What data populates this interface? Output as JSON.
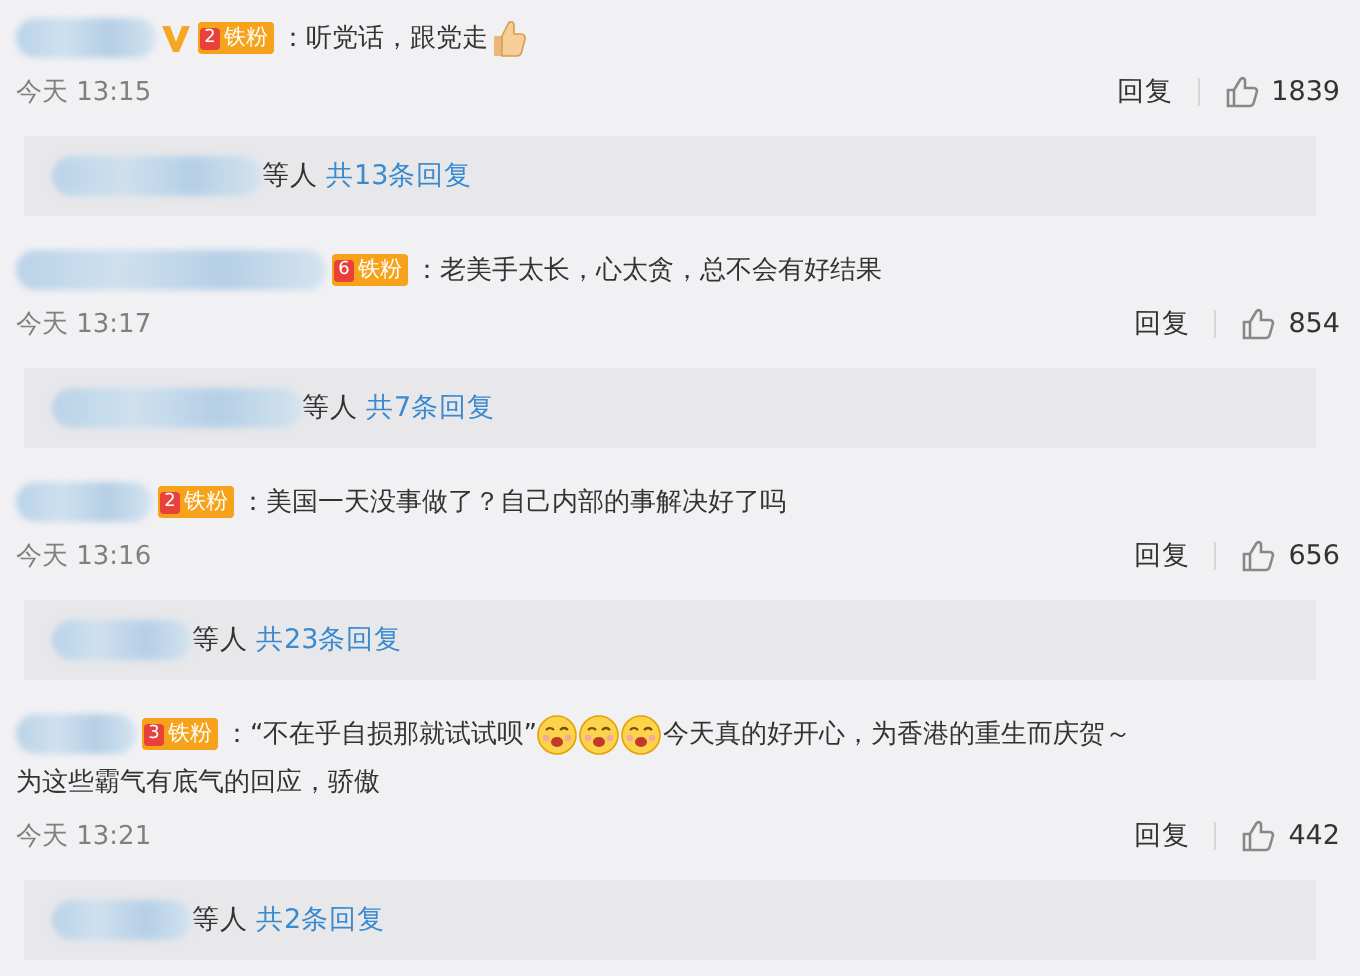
{
  "comments": [
    {
      "verified": true,
      "fan_badge": {
        "level": "2",
        "label": "铁粉"
      },
      "content": [
        {
          "kind": "text",
          "text": "：听党话，跟党走"
        },
        {
          "kind": "thumb"
        }
      ],
      "time": "今天 13:15",
      "reply_label": "回复",
      "likes": "1839",
      "replies": {
        "suffix": "等人",
        "link": "共13条回复"
      }
    },
    {
      "verified": false,
      "fan_badge": {
        "level": "6",
        "label": "铁粉"
      },
      "content": [
        {
          "kind": "text",
          "text": "：老美手太长，心太贪，总不会有好结果"
        }
      ],
      "time": "今天 13:17",
      "reply_label": "回复",
      "likes": "854",
      "replies": {
        "suffix": "等人",
        "link": "共7条回复"
      }
    },
    {
      "verified": false,
      "fan_badge": {
        "level": "2",
        "label": "铁粉"
      },
      "content": [
        {
          "kind": "text",
          "text": "：美国一天没事做了？自己内部的事解决好了吗"
        }
      ],
      "time": "今天 13:16",
      "reply_label": "回复",
      "likes": "656",
      "replies": {
        "suffix": "等人",
        "link": "共23条回复"
      }
    },
    {
      "verified": false,
      "fan_badge": {
        "level": "3",
        "label": "铁粉"
      },
      "content": [
        {
          "kind": "text",
          "text": "：“不在乎自损那就试试呗”"
        },
        {
          "kind": "face"
        },
        {
          "kind": "face"
        },
        {
          "kind": "face"
        },
        {
          "kind": "text",
          "text": "今天真的好开心，为香港的重生而庆贺～"
        },
        {
          "kind": "text",
          "text": "为这些霸气有底气的回应，骄傲"
        }
      ],
      "time": "今天 13:21",
      "reply_label": "回复",
      "likes": "442",
      "replies": {
        "suffix": "等人",
        "link": "共2条回复"
      }
    }
  ]
}
